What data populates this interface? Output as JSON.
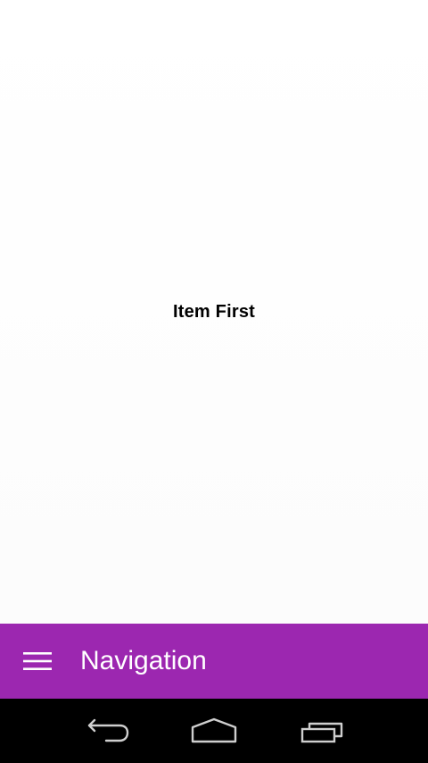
{
  "main": {
    "center_text": "Item First"
  },
  "app_bar": {
    "title": "Navigation",
    "background_color": "#9c27b0",
    "menu_icon": "hamburger-menu-icon"
  },
  "system_nav": {
    "background_color": "#000000",
    "buttons": [
      "back-icon",
      "home-icon",
      "recent-apps-icon"
    ]
  }
}
